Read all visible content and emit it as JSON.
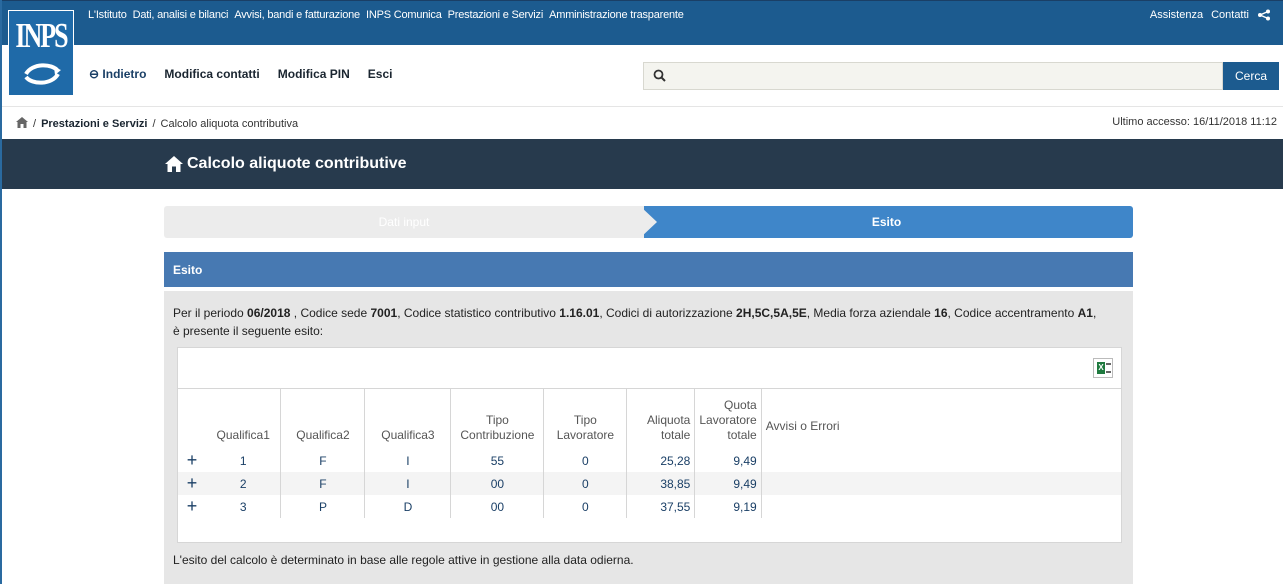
{
  "header": {
    "logo_text": "INPS",
    "top_links": [
      "L'Istituto",
      "Dati, analisi e bilanci",
      "Avvisi, bandi e fatturazione",
      "INPS Comunica",
      "Prestazioni e Servizi",
      "Amministrazione trasparente"
    ],
    "right_links": [
      "Assistenza",
      "Contatti"
    ],
    "nav": {
      "back": "Indietro",
      "edit_contacts": "Modifica contatti",
      "edit_pin": "Modifica PIN",
      "exit": "Esci"
    },
    "search": {
      "placeholder": "",
      "button": "Cerca"
    }
  },
  "breadcrumb": {
    "items": [
      "Prestazioni e Servizi",
      "Calcolo aliquota contributiva"
    ],
    "separator": "/"
  },
  "last_access": "Ultimo accesso: 16/11/2018 11:12",
  "page_title": "Calcolo aliquote contributive",
  "steps": {
    "step1": "Dati input",
    "step2": "Esito"
  },
  "panel": {
    "title": "Esito",
    "intro": {
      "p1": "Per il periodo ",
      "periodo": "06/2018",
      "p2": " , Codice sede ",
      "sede": "7001",
      "p3": ", Codice statistico contributivo ",
      "csc": "1.16.01",
      "p4": ", Codici di autorizzazione ",
      "auth": "2H,5C,5A,5E",
      "p5": ", Media forza aziendale ",
      "forza": "16",
      "p6": ", Codice accentramento ",
      "accentramento": "A1",
      "p7": ", è presente il seguente esito:"
    },
    "table": {
      "headers": [
        "Qualifica1",
        "Qualifica2",
        "Qualifica3",
        "Tipo Contribuzione",
        "Tipo Lavoratore",
        "Aliquota totale",
        "Quota Lavoratore totale",
        "Avvisi o Errori"
      ],
      "rows": [
        [
          "1",
          "F",
          "I",
          "55",
          "0",
          "25,28",
          "9,49",
          ""
        ],
        [
          "2",
          "F",
          "I",
          "00",
          "0",
          "38,85",
          "9,49",
          ""
        ],
        [
          "3",
          "P",
          "D",
          "00",
          "0",
          "37,55",
          "9,19",
          ""
        ]
      ],
      "expand_symbol": "+"
    },
    "footer_note": "L'esito del calcolo è determinato in base alle regole attive in gestione alla data odierna."
  },
  "colors": {
    "brand_blue": "#1c5b8f",
    "title_bar": "#273a4d",
    "panel_head": "#4779b2",
    "step_active": "#3f86c9"
  }
}
